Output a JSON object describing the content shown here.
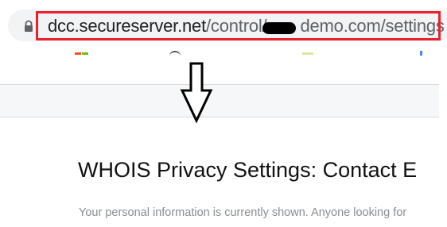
{
  "browser": {
    "url_host": "dcc.secureserver.net",
    "url_path_before": "/control/",
    "url_path_after": "demo.com/settings",
    "highlight_color": "#e8212d",
    "lock_icon": "lock-icon"
  },
  "annotation": {
    "arrow_icon": "down-arrow-icon"
  },
  "page": {
    "title": "WHOIS Privacy Settings: Contact E",
    "description": "Your personal information is currently shown. Anyone looking for"
  }
}
